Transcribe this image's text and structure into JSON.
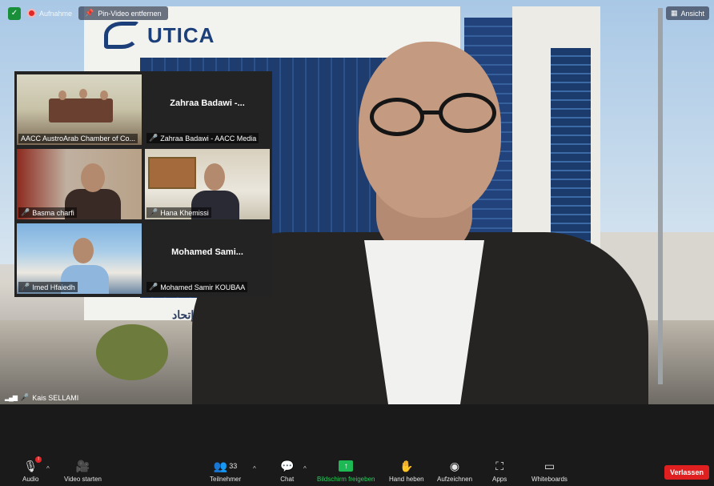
{
  "top_controls": {
    "recording_label": "Aufnahme",
    "pin_video_label": "Pin-Video entfernen",
    "view_label": "Ansicht"
  },
  "background_scene": {
    "building_sign": "UTICA",
    "facade_text": "إتحاد"
  },
  "gallery": {
    "tiles": [
      {
        "label": "AACC AustroArab Chamber of Co...",
        "big_name": ""
      },
      {
        "label": "Zahraa Badawi - AACC Media",
        "big_name": "Zahraa Badawi -..."
      },
      {
        "label": "Basma charfi",
        "big_name": ""
      },
      {
        "label": "Hana Khemissi",
        "big_name": ""
      },
      {
        "label": "Imed Hfaiedh",
        "big_name": ""
      },
      {
        "label": "Mohamed Samir KOUBAA",
        "big_name": "Mohamed Sami..."
      }
    ]
  },
  "active_speaker": {
    "name": "Kais SELLAMI"
  },
  "toolbar": {
    "audio_label": "Audio",
    "video_label": "Video starten",
    "participants_label": "Teilnehmer",
    "participants_count": "33",
    "chat_label": "Chat",
    "share_label": "Bildschirm freigeben",
    "raise_hand_label": "Hand heben",
    "record_label": "Aufzeichnen",
    "apps_label": "Apps",
    "whiteboards_label": "Whiteboards",
    "leave_label": "Verlassen"
  },
  "colors": {
    "toolbar_bg": "#1a1a1a",
    "share_green": "#1db954",
    "leave_red": "#e02020",
    "mic_muted_red": "#e53935"
  }
}
